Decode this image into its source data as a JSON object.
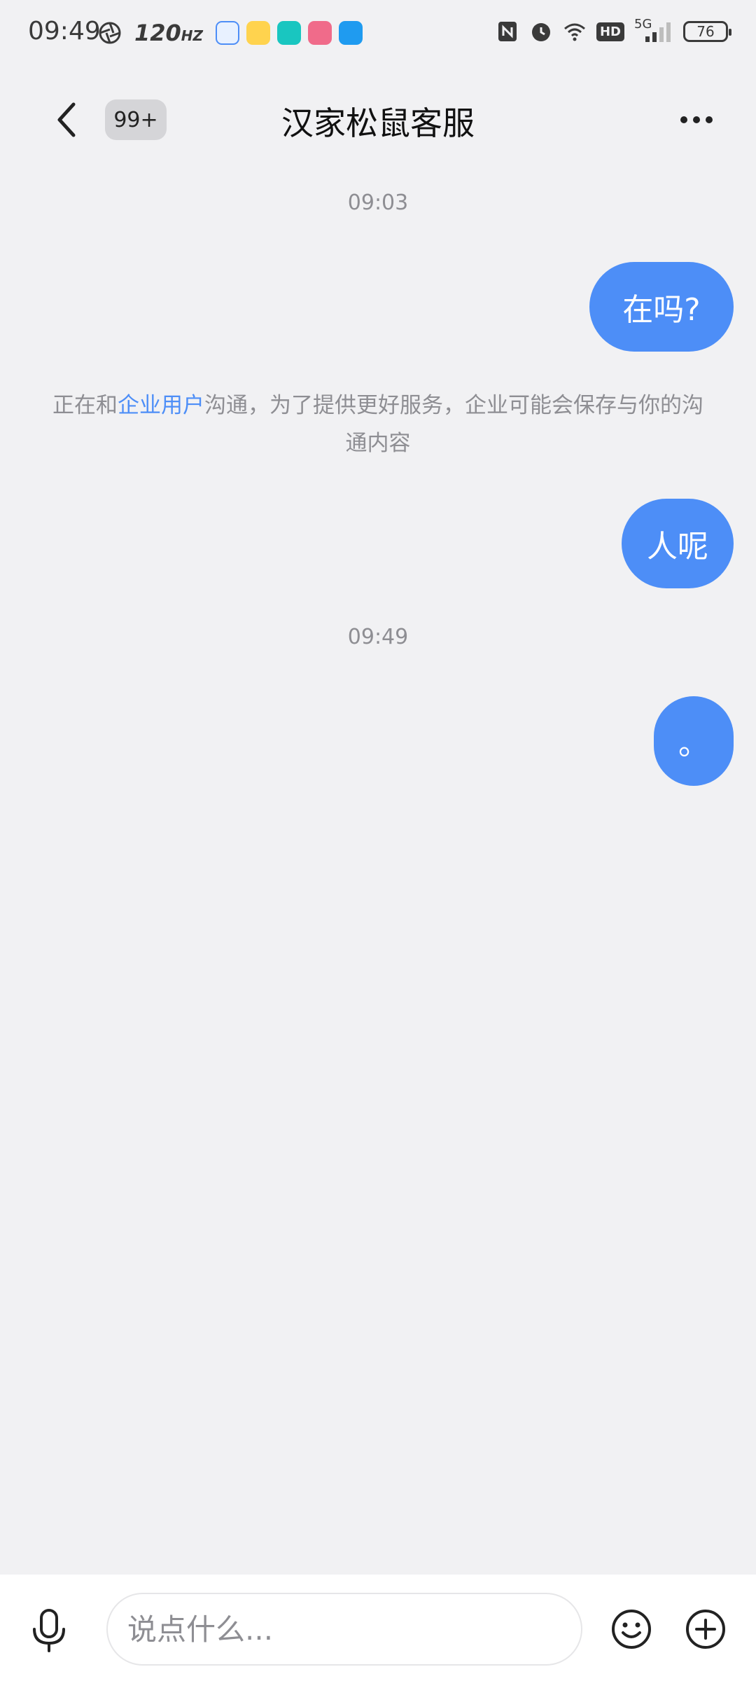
{
  "status_bar": {
    "time": "09:49",
    "refresh_rate": "120",
    "refresh_unit": "HZ",
    "hd_label": "HD",
    "network_label": "5G",
    "battery": "76"
  },
  "header": {
    "unread_count": "99+",
    "title": "汉家松鼠客服"
  },
  "messages": [
    {
      "type": "timestamp",
      "text": "09:03"
    },
    {
      "type": "sent",
      "text": "在吗?"
    },
    {
      "type": "system",
      "pre": "正在和",
      "link": "企业用户",
      "post": "沟通，为了提供更好服务，企业可能会保存与你的沟通内容"
    },
    {
      "type": "sent",
      "text": "人呢"
    },
    {
      "type": "timestamp",
      "text": "09:49"
    },
    {
      "type": "sent",
      "text": "。"
    }
  ],
  "input": {
    "placeholder": "说点什么..."
  },
  "colors": {
    "accent": "#4d8ef7",
    "background": "#f1f1f3",
    "muted_text": "#8e8e93"
  },
  "icons": {
    "back": "chevron-left-icon",
    "more": "more-dots-icon",
    "voice": "microphone-icon",
    "emoji": "smiley-icon",
    "plus": "plus-circle-icon"
  }
}
